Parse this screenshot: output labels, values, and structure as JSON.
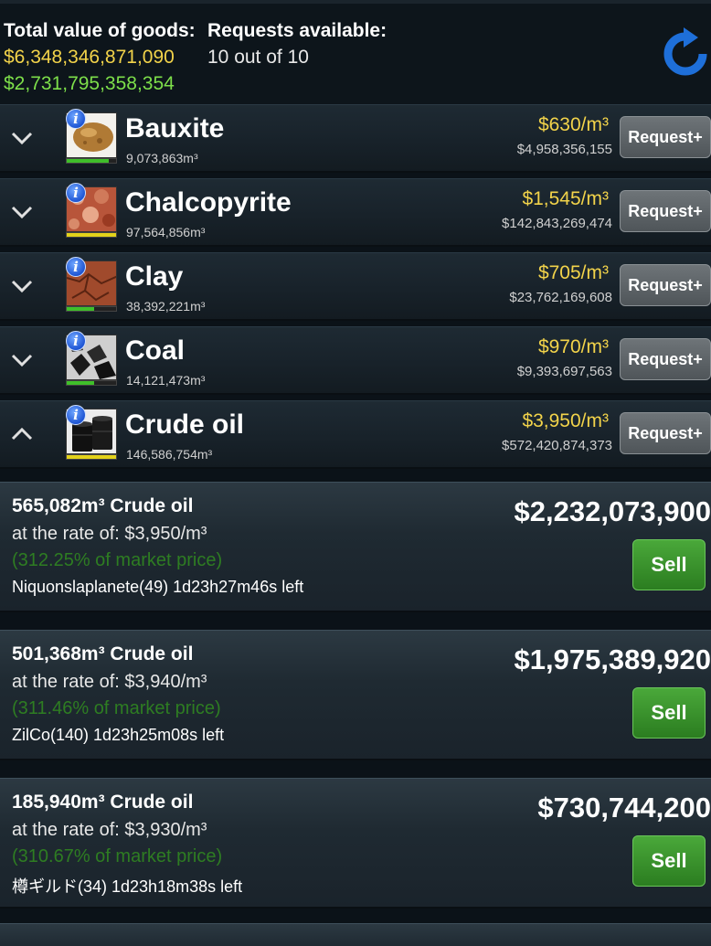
{
  "header": {
    "total_label": "Total value of goods:",
    "total_yellow": "$6,348,346,871,090",
    "total_green": "$2,731,795,358,354",
    "requests_label": "Requests available:",
    "requests_value": "10 out of 10"
  },
  "resources": [
    {
      "name": "Bauxite",
      "qty": "9,073,863m³",
      "price": "$630/m³",
      "total": "$4,958,356,155",
      "button": "Request+",
      "bar_color": "#3fbf2a",
      "bar_fill": 0.85,
      "expanded": false
    },
    {
      "name": "Chalcopyrite",
      "qty": "97,564,856m³",
      "price": "$1,545/m³",
      "total": "$142,843,269,474",
      "button": "Request+",
      "bar_color": "#e3d21a",
      "bar_fill": 1.0,
      "expanded": false
    },
    {
      "name": "Clay",
      "qty": "38,392,221m³",
      "price": "$705/m³",
      "total": "$23,762,169,608",
      "button": "Request+",
      "bar_color": "#3fbf2a",
      "bar_fill": 0.55,
      "expanded": false
    },
    {
      "name": "Coal",
      "qty": "14,121,473m³",
      "price": "$970/m³",
      "total": "$9,393,697,563",
      "button": "Request+",
      "bar_color": "#3fbf2a",
      "bar_fill": 0.55,
      "expanded": false
    },
    {
      "name": "Crude oil",
      "qty": "146,586,754m³",
      "price": "$3,950/m³",
      "total": "$572,420,874,373",
      "button": "Request+",
      "bar_color": "#e3d21a",
      "bar_fill": 1.0,
      "expanded": true
    }
  ],
  "offers": [
    {
      "title": "565,082m³ Crude oil",
      "rate": "at the rate of: $3,950/m³",
      "pct": "(312.25% of market price)",
      "seller": "Niquonslaplanete(49) 1d23h27m46s left",
      "total": "$2,232,073,900",
      "button": "Sell"
    },
    {
      "title": "501,368m³ Crude oil",
      "rate": "at the rate of: $3,940/m³",
      "pct": "(311.46% of market price)",
      "seller": "ZilCo(140) 1d23h25m08s left",
      "total": "$1,975,389,920",
      "button": "Sell"
    },
    {
      "title": "185,940m³ Crude oil",
      "rate": "at the rate of: $3,930/m³",
      "pct": "(310.67% of market price)",
      "seller": "樽ギルド(34) 1d23h18m38s left",
      "total": "$730,744,200",
      "button": "Sell"
    }
  ],
  "icons": {
    "refresh": "refresh-icon",
    "info": "info-icon",
    "chevron_down": "chevron-down-icon",
    "chevron_up": "chevron-up-icon"
  },
  "colors": {
    "accent_blue": "#1e6fd9",
    "price_yellow": "#f2d34a",
    "value_green": "#7ddf4a",
    "sell_green": "#2b7d20"
  }
}
